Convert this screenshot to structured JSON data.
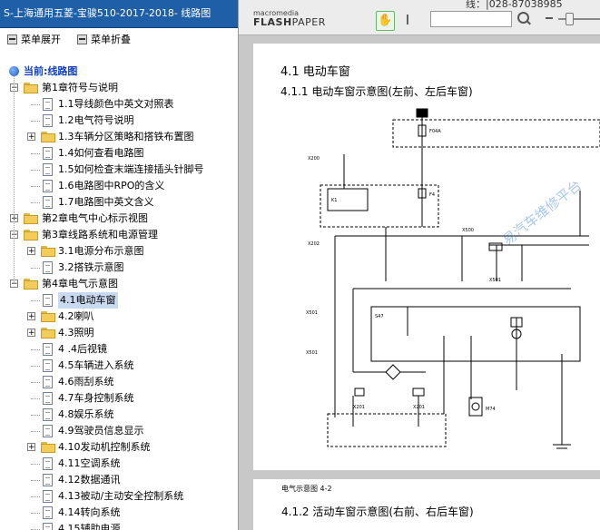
{
  "left_panel": {
    "title": "S-上海通用五菱-宝骏510-2017-2018- 线路图",
    "toolbar": {
      "expand_label": "菜单展开",
      "collapse_label": "菜单折叠"
    },
    "current_label": "当前:线路图",
    "tree": [
      {
        "label": "第1章符号与说明",
        "type": "folder",
        "level": 1,
        "expander": "−"
      },
      {
        "label": "1.1导线颜色中英文对照表",
        "type": "doc",
        "level": 2
      },
      {
        "label": "1.2电气符号说明",
        "type": "doc",
        "level": 2
      },
      {
        "label": "1.3车辆分区策略和搭铁布置图",
        "type": "folder",
        "level": 2,
        "expander": "+"
      },
      {
        "label": "1.4如何查看电路图",
        "type": "doc",
        "level": 2
      },
      {
        "label": "1.5如何检查末端连接插头针脚号",
        "type": "doc",
        "level": 2
      },
      {
        "label": "1.6电路图中RPO的含义",
        "type": "doc",
        "level": 2
      },
      {
        "label": "1.7电路图中英文含义",
        "type": "doc",
        "level": 2
      },
      {
        "label": "第2章电气中心标示视图",
        "type": "folder",
        "level": 1,
        "expander": "+"
      },
      {
        "label": "第3章线路系统和电源管理",
        "type": "folder",
        "level": 1,
        "expander": "−"
      },
      {
        "label": "3.1电源分布示意图",
        "type": "folder",
        "level": 2,
        "expander": "+"
      },
      {
        "label": "3.2搭铁示意图",
        "type": "doc",
        "level": 2
      },
      {
        "label": "第4章电气示意图",
        "type": "folder",
        "level": 1,
        "expander": "−"
      },
      {
        "label": "4.1电动车窗",
        "type": "doc",
        "level": 2,
        "selected": true
      },
      {
        "label": "4.2喇叭",
        "type": "folder",
        "level": 2,
        "expander": "+"
      },
      {
        "label": "4.3照明",
        "type": "folder",
        "level": 2,
        "expander": "+"
      },
      {
        "label": "4 .4后视镜",
        "type": "doc",
        "level": 2
      },
      {
        "label": "4.5车辆进入系统",
        "type": "doc",
        "level": 2
      },
      {
        "label": "4.6雨刮系统",
        "type": "doc",
        "level": 2
      },
      {
        "label": "4.7车身控制系统",
        "type": "doc",
        "level": 2
      },
      {
        "label": "4.8娱乐系统",
        "type": "doc",
        "level": 2
      },
      {
        "label": "4.9驾驶员信息显示",
        "type": "doc",
        "level": 2
      },
      {
        "label": "4.10发动机控制系统",
        "type": "folder",
        "level": 2,
        "expander": "+"
      },
      {
        "label": "4.11空调系统",
        "type": "doc",
        "level": 2
      },
      {
        "label": "4.12数据通讯",
        "type": "doc",
        "level": 2
      },
      {
        "label": "4.13被动/主动安全控制系统",
        "type": "doc",
        "level": 2
      },
      {
        "label": "4.14转向系统",
        "type": "doc",
        "level": 2
      },
      {
        "label": "4.15辅助电源",
        "type": "doc",
        "level": 2
      }
    ]
  },
  "viewer": {
    "logo_small": "macromedia",
    "logo_big_a": "FLASH",
    "logo_big_b": "PAPER",
    "top_cut_text": "线：|028-87038985",
    "section_title": "4.1 电动车窗",
    "subsection_title": "4.1.1 电动车窗示意图(左前、左后车窗)",
    "figure_caption": "电气示意图 4-2",
    "next_subsection_title": "4.1.2 活动车窗示意图(右前、右后车窗)",
    "watermark": "易汽车维修平台"
  },
  "colors": {
    "title_bar": "#1f5fa8",
    "selected": "#c9d9ef",
    "folder": "#f3cc5a"
  }
}
